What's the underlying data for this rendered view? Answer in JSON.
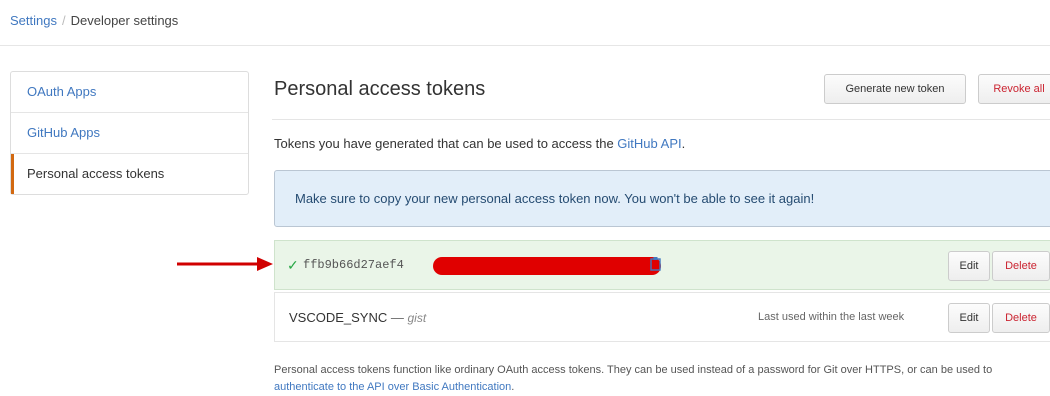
{
  "breadcrumb": {
    "settings": "Settings",
    "separator": "/",
    "current": "Developer settings"
  },
  "sidebar": {
    "items": [
      {
        "label": "OAuth Apps"
      },
      {
        "label": "GitHub Apps"
      },
      {
        "label": "Personal access tokens",
        "selected": true
      }
    ]
  },
  "main": {
    "title": "Personal access tokens",
    "generate_button": "Generate new token",
    "revoke_button": "Revoke all",
    "description_prefix": "Tokens you have generated that can be used to access the ",
    "description_link": "GitHub API",
    "description_suffix": ".",
    "flash": "Make sure to copy your new personal access token now. You won't be able to see it again!",
    "new_token": {
      "value": "ffb9b66d27aef4",
      "edit": "Edit",
      "delete": "Delete"
    },
    "tokens": [
      {
        "name": "VSCODE_SYNC",
        "dash": "—",
        "scope": "gist",
        "last_used": "Last used within the last week",
        "edit": "Edit",
        "delete": "Delete"
      }
    ],
    "footer_text": "Personal access tokens function like ordinary OAuth access tokens. They can be used instead of a password for Git over HTTPS, or can be used to ",
    "footer_link": "authenticate to the API over Basic Authentication",
    "footer_end": "."
  },
  "colors": {
    "link": "#4078c0",
    "danger": "#cb2431",
    "success_bg": "#eaf5e8",
    "flash_bg": "#e2eef9",
    "annotation_arrow": "#d00000",
    "redaction": "#e00000",
    "selected_border": "#d26911"
  }
}
